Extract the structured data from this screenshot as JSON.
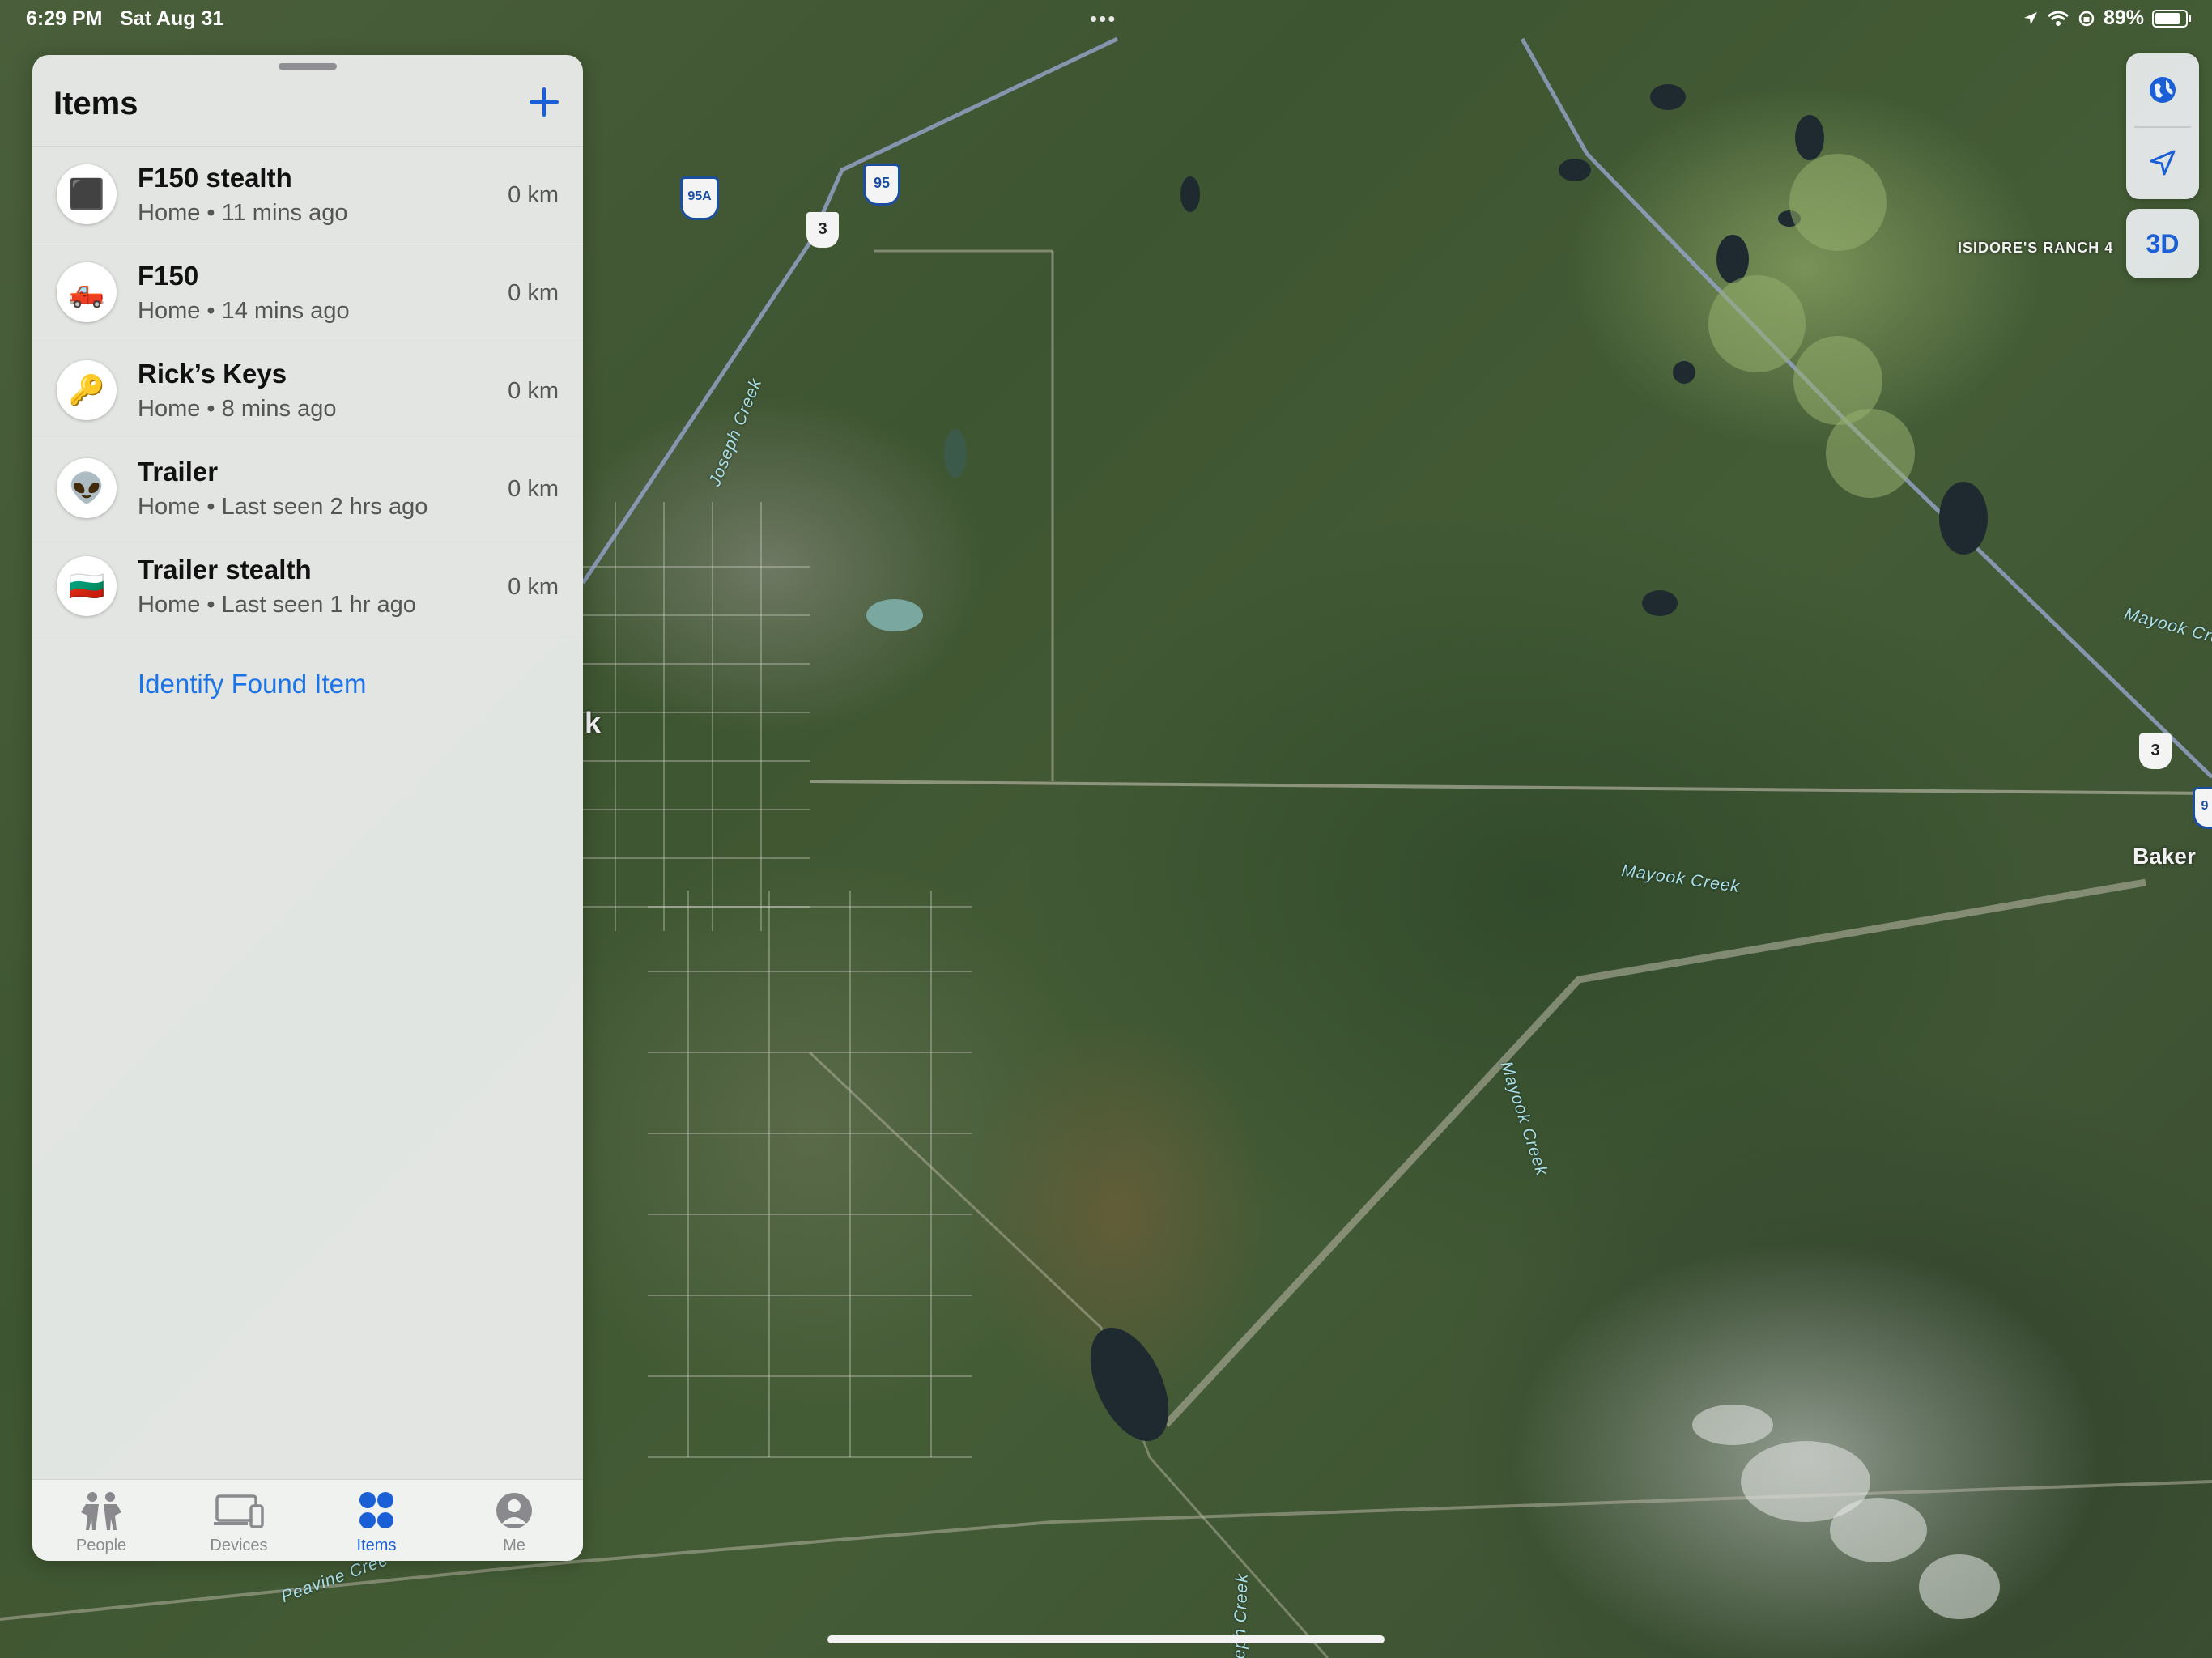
{
  "status_bar": {
    "time": "6:29 PM",
    "date": "Sat Aug 31",
    "battery": "89%",
    "battery_level": 0.89
  },
  "panel": {
    "title": "Items",
    "add_icon": "plus-icon",
    "items": [
      {
        "name": "F150 stealth",
        "location": "Home",
        "last_seen": "11 mins ago",
        "distance": "0 km",
        "emoji": "⬛"
      },
      {
        "name": "F150",
        "location": "Home",
        "last_seen": "14 mins ago",
        "distance": "0 km",
        "emoji": "🛻"
      },
      {
        "name": "Rick’s Keys",
        "location": "Home",
        "last_seen": "8 mins ago",
        "distance": "0 km",
        "emoji": "🔑"
      },
      {
        "name": "Trailer",
        "location": "Home",
        "last_seen": "Last seen 2 hrs ago",
        "distance": "0 km",
        "emoji": "👽"
      },
      {
        "name": "Trailer stealth",
        "location": "Home",
        "last_seen": "Last seen 1 hr ago",
        "distance": "0 km",
        "emoji": "🇧🇬"
      }
    ],
    "separator": "•",
    "identify_link": "Identify Found Item"
  },
  "tabs": [
    {
      "label": "People",
      "icon": "people-icon",
      "active": false
    },
    {
      "label": "Devices",
      "icon": "devices-icon",
      "active": false
    },
    {
      "label": "Items",
      "icon": "items-icon",
      "active": true
    },
    {
      "label": "Me",
      "icon": "me-icon",
      "active": false
    }
  ],
  "map": {
    "controls": {
      "globe_icon": "globe-icon",
      "location_icon": "location-arrow-icon",
      "view_3d": "3D"
    },
    "labels": {
      "ranch": "ISIDORE'S RANCH 4",
      "town": "Baker",
      "partial_town": "k",
      "mayook_creek": "Mayook Creek",
      "mayook_creek_partial": "Mayook Cre",
      "joseph_creek": "Joseph Creek",
      "peavine_creek": "Peavine Cree",
      "bottom_creek": "seph Creek",
      "hwy_95a": "95A",
      "hwy_95": "95",
      "hwy_95_partial": "9",
      "hwy_3": "3"
    }
  },
  "colors": {
    "accent": "#1a5fd6",
    "link": "#1a73e8",
    "panel_bg": "#eceeec",
    "map_green": "#3e5531"
  }
}
